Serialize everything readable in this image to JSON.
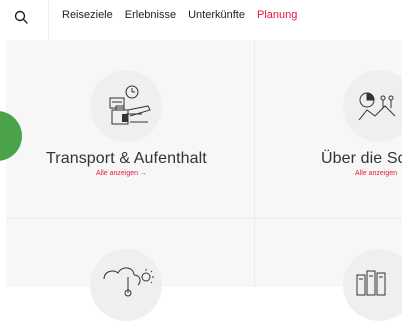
{
  "nav": {
    "items": [
      {
        "label": "Reiseziele",
        "active": false
      },
      {
        "label": "Erlebnisse",
        "active": false
      },
      {
        "label": "Unterkünfte",
        "active": false
      },
      {
        "label": "Planung",
        "active": true
      }
    ]
  },
  "cards": [
    {
      "title": "Transport & Aufenthalt",
      "link": "Alle anzeigen →",
      "icon": "luggage-calendar-icon"
    },
    {
      "title": "Über die Sc",
      "link": "Alle anzeigen",
      "icon": "chart-people-icon"
    },
    {
      "title": "",
      "link": "",
      "icon": "weather-icon"
    },
    {
      "title": "",
      "link": "",
      "icon": "books-icon"
    }
  ],
  "colors": {
    "accent": "#e5173f",
    "green": "#4aa24a"
  }
}
